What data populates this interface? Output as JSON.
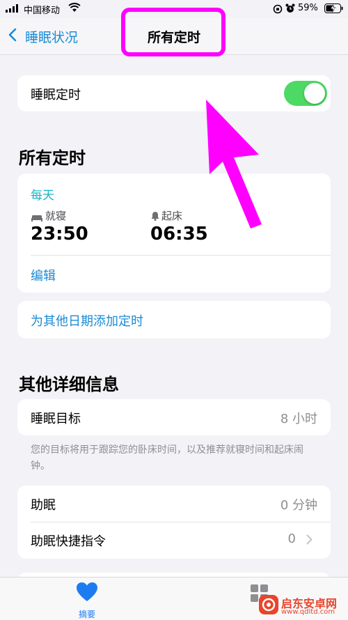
{
  "status_bar": {
    "carrier": "中国移动",
    "battery": "59%"
  },
  "nav": {
    "back_label": "睡眠状况",
    "title": "所有定时"
  },
  "sleep_schedule": {
    "label": "睡眠定时",
    "enabled": true
  },
  "section_all": {
    "heading": "所有定时",
    "schedule": {
      "days": "每天",
      "bedtime_label": "就寝",
      "bedtime": "23:50",
      "wake_label": "起床",
      "wake": "06:35",
      "edit_label": "编辑"
    },
    "add_label": "为其他日期添加定时"
  },
  "section_details": {
    "heading": "其他详细信息",
    "sleep_goal_label": "睡眠目标",
    "sleep_goal_value": "8 小时",
    "footnote": "您的目标将用于跟踪您的卧床时间，以及推荐就寝时间和起床闹钟。",
    "wind_down_label": "助眠",
    "wind_down_value": "0 分钟",
    "shortcuts_label": "助眠快捷指令",
    "shortcuts_value": "0"
  },
  "tab_bar": {
    "summary_label": "摘要"
  },
  "watermark": {
    "brand": "启东安卓网",
    "url": "www.qdltd.com"
  },
  "colors": {
    "accent_blue": "#1a8bd6",
    "teal": "#11b3c4",
    "toggle_green": "#4cd964",
    "annotation_magenta": "#ff00ff"
  }
}
